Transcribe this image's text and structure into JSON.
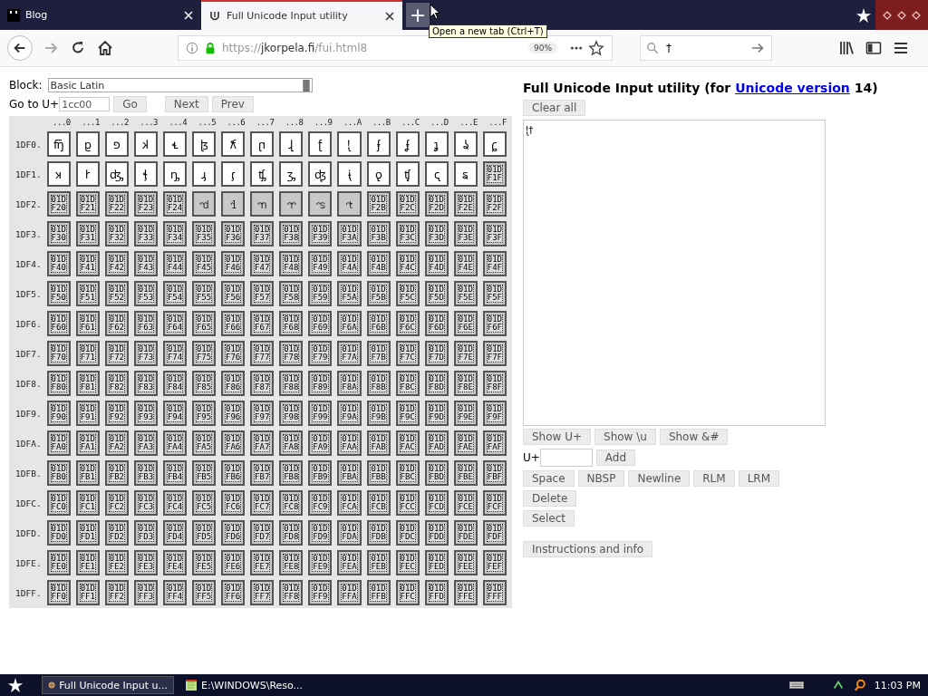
{
  "browser": {
    "tabs": [
      {
        "title": "Blog",
        "selected": false
      },
      {
        "title": "Full Unicode Input utility",
        "selected": true
      }
    ],
    "new_tab": "+",
    "tooltip": "Open a new tab (Ctrl+T)",
    "forward_disabled": true,
    "url": {
      "scheme": "https://",
      "host": "jkorpela.fi",
      "path": "/fui.html8"
    },
    "zoom": "90%",
    "search_value": "†"
  },
  "page": {
    "block_label": "Block:",
    "block_value": "Basic Latin",
    "goto_label": "Go to U+",
    "goto_value": "1cc00",
    "nav_buttons": [
      "Go",
      "Next",
      "Prev"
    ],
    "grid": {
      "columns": [
        "...0",
        "...1",
        "...2",
        "...3",
        "...4",
        "...5",
        "...6",
        "...7",
        "...8",
        "...9",
        "...A",
        "...B",
        "...C",
        "...D",
        "...E",
        "...F"
      ],
      "rows": [
        {
          "label": "1DF0.",
          "cells": [
            {
              "kind": "glyph",
              "char": "𝼀",
              "assigned": true
            },
            {
              "kind": "glyph",
              "char": "𝼁",
              "assigned": true
            },
            {
              "kind": "glyph",
              "char": "𝼂",
              "assigned": true
            },
            {
              "kind": "glyph",
              "char": "𝼃",
              "assigned": true
            },
            {
              "kind": "glyph",
              "char": "𝼄",
              "assigned": true
            },
            {
              "kind": "glyph",
              "char": "𝼅",
              "assigned": true
            },
            {
              "kind": "glyph",
              "char": "𝼆",
              "assigned": true
            },
            {
              "kind": "glyph",
              "char": "𝼇",
              "assigned": true
            },
            {
              "kind": "glyph",
              "char": "𝼈",
              "assigned": true
            },
            {
              "kind": "glyph",
              "char": "𝼉",
              "assigned": true
            },
            {
              "kind": "glyph",
              "char": "𝼊",
              "assigned": true
            },
            {
              "kind": "glyph",
              "char": "𝼋",
              "assigned": true
            },
            {
              "kind": "glyph",
              "char": "𝼌",
              "assigned": true
            },
            {
              "kind": "glyph",
              "char": "𝼍",
              "assigned": true
            },
            {
              "kind": "glyph",
              "char": "𝼎",
              "assigned": true
            },
            {
              "kind": "glyph",
              "char": "𝼏",
              "assigned": true
            }
          ]
        },
        {
          "label": "1DF1.",
          "cells": [
            {
              "kind": "glyph",
              "char": "𝼐",
              "assigned": true
            },
            {
              "kind": "glyph",
              "char": "𝼑",
              "assigned": true
            },
            {
              "kind": "glyph",
              "char": "𝼒",
              "assigned": true
            },
            {
              "kind": "glyph",
              "char": "𝼓",
              "assigned": true
            },
            {
              "kind": "glyph",
              "char": "𝼔",
              "assigned": true
            },
            {
              "kind": "glyph",
              "char": "𝼕",
              "assigned": true
            },
            {
              "kind": "glyph",
              "char": "𝼖",
              "assigned": true
            },
            {
              "kind": "glyph",
              "char": "𝼗",
              "assigned": true
            },
            {
              "kind": "glyph",
              "char": "𝼘",
              "assigned": true
            },
            {
              "kind": "glyph",
              "char": "𝼙",
              "assigned": true
            },
            {
              "kind": "glyph",
              "char": "𝼚",
              "assigned": true
            },
            {
              "kind": "glyph",
              "char": "𝼛",
              "assigned": true
            },
            {
              "kind": "glyph",
              "char": "𝼜",
              "assigned": true
            },
            {
              "kind": "glyph",
              "char": "𝼝",
              "assigned": true
            },
            {
              "kind": "glyph",
              "char": "𝼞",
              "assigned": true
            },
            {
              "kind": "hex",
              "code": "01DF1F",
              "assigned": false
            }
          ]
        },
        {
          "label": "1DF2.",
          "cells": [
            {
              "kind": "hex",
              "code": "01DF20",
              "assigned": false
            },
            {
              "kind": "hex",
              "code": "01DF21",
              "assigned": false
            },
            {
              "kind": "hex",
              "code": "01DF22",
              "assigned": false
            },
            {
              "kind": "hex",
              "code": "01DF23",
              "assigned": false
            },
            {
              "kind": "hex",
              "code": "01DF24",
              "assigned": false
            },
            {
              "kind": "glyph",
              "char": "𝼥",
              "assigned": false
            },
            {
              "kind": "glyph",
              "char": "𝼦",
              "assigned": false
            },
            {
              "kind": "glyph",
              "char": "𝼧",
              "assigned": false
            },
            {
              "kind": "glyph",
              "char": "𝼨",
              "assigned": false
            },
            {
              "kind": "glyph",
              "char": "𝼩",
              "assigned": false
            },
            {
              "kind": "glyph",
              "char": "𝼪",
              "assigned": false
            },
            {
              "kind": "hex",
              "code": "01DF2B",
              "assigned": false
            },
            {
              "kind": "hex",
              "code": "01DF2C",
              "assigned": false
            },
            {
              "kind": "hex",
              "code": "01DF2D",
              "assigned": false
            },
            {
              "kind": "hex",
              "code": "01DF2E",
              "assigned": false
            },
            {
              "kind": "hex",
              "code": "01DF2F",
              "assigned": false
            }
          ]
        },
        {
          "label": "1DF3.",
          "cells": [
            {
              "kind": "hex",
              "code": "01DF30",
              "assigned": false
            },
            {
              "kind": "hex",
              "code": "01DF31",
              "assigned": false
            },
            {
              "kind": "hex",
              "code": "01DF32",
              "assigned": false
            },
            {
              "kind": "hex",
              "code": "01DF33",
              "assigned": false
            },
            {
              "kind": "hex",
              "code": "01DF34",
              "assigned": false
            },
            {
              "kind": "hex",
              "code": "01DF35",
              "assigned": false
            },
            {
              "kind": "hex",
              "code": "01DF36",
              "assigned": false
            },
            {
              "kind": "hex",
              "code": "01DF37",
              "assigned": false
            },
            {
              "kind": "hex",
              "code": "01DF38",
              "assigned": false
            },
            {
              "kind": "hex",
              "code": "01DF39",
              "assigned": false
            },
            {
              "kind": "hex",
              "code": "01DF3A",
              "assigned": false
            },
            {
              "kind": "hex",
              "code": "01DF3B",
              "assigned": false
            },
            {
              "kind": "hex",
              "code": "01DF3C",
              "assigned": false
            },
            {
              "kind": "hex",
              "code": "01DF3D",
              "assigned": false
            },
            {
              "kind": "hex",
              "code": "01DF3E",
              "assigned": false
            },
            {
              "kind": "hex",
              "code": "01DF3F",
              "assigned": false
            }
          ]
        },
        {
          "label": "1DF4.",
          "cells": [
            {
              "kind": "hex",
              "code": "01DF40",
              "assigned": false
            },
            {
              "kind": "hex",
              "code": "01DF41",
              "assigned": false
            },
            {
              "kind": "hex",
              "code": "01DF42",
              "assigned": false
            },
            {
              "kind": "hex",
              "code": "01DF43",
              "assigned": false
            },
            {
              "kind": "hex",
              "code": "01DF44",
              "assigned": false
            },
            {
              "kind": "hex",
              "code": "01DF45",
              "assigned": false
            },
            {
              "kind": "hex",
              "code": "01DF46",
              "assigned": false
            },
            {
              "kind": "hex",
              "code": "01DF47",
              "assigned": false
            },
            {
              "kind": "hex",
              "code": "01DF48",
              "assigned": false
            },
            {
              "kind": "hex",
              "code": "01DF49",
              "assigned": false
            },
            {
              "kind": "hex",
              "code": "01DF4A",
              "assigned": false
            },
            {
              "kind": "hex",
              "code": "01DF4B",
              "assigned": false
            },
            {
              "kind": "hex",
              "code": "01DF4C",
              "assigned": false
            },
            {
              "kind": "hex",
              "code": "01DF4D",
              "assigned": false
            },
            {
              "kind": "hex",
              "code": "01DF4E",
              "assigned": false
            },
            {
              "kind": "hex",
              "code": "01DF4F",
              "assigned": false
            }
          ]
        },
        {
          "label": "1DF5.",
          "cells": [
            {
              "kind": "hex",
              "code": "01DF50",
              "assigned": false
            },
            {
              "kind": "hex",
              "code": "01DF51",
              "assigned": false
            },
            {
              "kind": "hex",
              "code": "01DF52",
              "assigned": false
            },
            {
              "kind": "hex",
              "code": "01DF53",
              "assigned": false
            },
            {
              "kind": "hex",
              "code": "01DF54",
              "assigned": false
            },
            {
              "kind": "hex",
              "code": "01DF55",
              "assigned": false
            },
            {
              "kind": "hex",
              "code": "01DF56",
              "assigned": false
            },
            {
              "kind": "hex",
              "code": "01DF57",
              "assigned": false
            },
            {
              "kind": "hex",
              "code": "01DF58",
              "assigned": false
            },
            {
              "kind": "hex",
              "code": "01DF59",
              "assigned": false
            },
            {
              "kind": "hex",
              "code": "01DF5A",
              "assigned": false
            },
            {
              "kind": "hex",
              "code": "01DF5B",
              "assigned": false
            },
            {
              "kind": "hex",
              "code": "01DF5C",
              "assigned": false
            },
            {
              "kind": "hex",
              "code": "01DF5D",
              "assigned": false
            },
            {
              "kind": "hex",
              "code": "01DF5E",
              "assigned": false
            },
            {
              "kind": "hex",
              "code": "01DF5F",
              "assigned": false
            }
          ]
        },
        {
          "label": "1DF6.",
          "cells": [
            {
              "kind": "hex",
              "code": "01DF60",
              "assigned": false
            },
            {
              "kind": "hex",
              "code": "01DF61",
              "assigned": false
            },
            {
              "kind": "hex",
              "code": "01DF62",
              "assigned": false
            },
            {
              "kind": "hex",
              "code": "01DF63",
              "assigned": false
            },
            {
              "kind": "hex",
              "code": "01DF64",
              "assigned": false
            },
            {
              "kind": "hex",
              "code": "01DF65",
              "assigned": false
            },
            {
              "kind": "hex",
              "code": "01DF66",
              "assigned": false
            },
            {
              "kind": "hex",
              "code": "01DF67",
              "assigned": false
            },
            {
              "kind": "hex",
              "code": "01DF68",
              "assigned": false
            },
            {
              "kind": "hex",
              "code": "01DF69",
              "assigned": false
            },
            {
              "kind": "hex",
              "code": "01DF6A",
              "assigned": false
            },
            {
              "kind": "hex",
              "code": "01DF6B",
              "assigned": false
            },
            {
              "kind": "hex",
              "code": "01DF6C",
              "assigned": false
            },
            {
              "kind": "hex",
              "code": "01DF6D",
              "assigned": false
            },
            {
              "kind": "hex",
              "code": "01DF6E",
              "assigned": false
            },
            {
              "kind": "hex",
              "code": "01DF6F",
              "assigned": false
            }
          ]
        },
        {
          "label": "1DF7.",
          "cells": [
            {
              "kind": "hex",
              "code": "01DF70",
              "assigned": false
            },
            {
              "kind": "hex",
              "code": "01DF71",
              "assigned": false
            },
            {
              "kind": "hex",
              "code": "01DF72",
              "assigned": false
            },
            {
              "kind": "hex",
              "code": "01DF73",
              "assigned": false
            },
            {
              "kind": "hex",
              "code": "01DF74",
              "assigned": false
            },
            {
              "kind": "hex",
              "code": "01DF75",
              "assigned": false
            },
            {
              "kind": "hex",
              "code": "01DF76",
              "assigned": false
            },
            {
              "kind": "hex",
              "code": "01DF77",
              "assigned": false
            },
            {
              "kind": "hex",
              "code": "01DF78",
              "assigned": false
            },
            {
              "kind": "hex",
              "code": "01DF79",
              "assigned": false
            },
            {
              "kind": "hex",
              "code": "01DF7A",
              "assigned": false
            },
            {
              "kind": "hex",
              "code": "01DF7B",
              "assigned": false
            },
            {
              "kind": "hex",
              "code": "01DF7C",
              "assigned": false
            },
            {
              "kind": "hex",
              "code": "01DF7D",
              "assigned": false
            },
            {
              "kind": "hex",
              "code": "01DF7E",
              "assigned": false
            },
            {
              "kind": "hex",
              "code": "01DF7F",
              "assigned": false
            }
          ]
        },
        {
          "label": "1DF8.",
          "cells": [
            {
              "kind": "hex",
              "code": "01DF80",
              "assigned": false
            },
            {
              "kind": "hex",
              "code": "01DF81",
              "assigned": false
            },
            {
              "kind": "hex",
              "code": "01DF82",
              "assigned": false
            },
            {
              "kind": "hex",
              "code": "01DF83",
              "assigned": false
            },
            {
              "kind": "hex",
              "code": "01DF84",
              "assigned": false
            },
            {
              "kind": "hex",
              "code": "01DF85",
              "assigned": false
            },
            {
              "kind": "hex",
              "code": "01DF86",
              "assigned": false
            },
            {
              "kind": "hex",
              "code": "01DF87",
              "assigned": false
            },
            {
              "kind": "hex",
              "code": "01DF88",
              "assigned": false
            },
            {
              "kind": "hex",
              "code": "01DF89",
              "assigned": false
            },
            {
              "kind": "hex",
              "code": "01DF8A",
              "assigned": false
            },
            {
              "kind": "hex",
              "code": "01DF8B",
              "assigned": false
            },
            {
              "kind": "hex",
              "code": "01DF8C",
              "assigned": false
            },
            {
              "kind": "hex",
              "code": "01DF8D",
              "assigned": false
            },
            {
              "kind": "hex",
              "code": "01DF8E",
              "assigned": false
            },
            {
              "kind": "hex",
              "code": "01DF8F",
              "assigned": false
            }
          ]
        },
        {
          "label": "1DF9.",
          "cells": [
            {
              "kind": "hex",
              "code": "01DF90",
              "assigned": false
            },
            {
              "kind": "hex",
              "code": "01DF91",
              "assigned": false
            },
            {
              "kind": "hex",
              "code": "01DF92",
              "assigned": false
            },
            {
              "kind": "hex",
              "code": "01DF93",
              "assigned": false
            },
            {
              "kind": "hex",
              "code": "01DF94",
              "assigned": false
            },
            {
              "kind": "hex",
              "code": "01DF95",
              "assigned": false
            },
            {
              "kind": "hex",
              "code": "01DF96",
              "assigned": false
            },
            {
              "kind": "hex",
              "code": "01DF97",
              "assigned": false
            },
            {
              "kind": "hex",
              "code": "01DF98",
              "assigned": false
            },
            {
              "kind": "hex",
              "code": "01DF99",
              "assigned": false
            },
            {
              "kind": "hex",
              "code": "01DF9A",
              "assigned": false
            },
            {
              "kind": "hex",
              "code": "01DF9B",
              "assigned": false
            },
            {
              "kind": "hex",
              "code": "01DF9C",
              "assigned": false
            },
            {
              "kind": "hex",
              "code": "01DF9D",
              "assigned": false
            },
            {
              "kind": "hex",
              "code": "01DF9E",
              "assigned": false
            },
            {
              "kind": "hex",
              "code": "01DF9F",
              "assigned": false
            }
          ]
        },
        {
          "label": "1DFA.",
          "cells": [
            {
              "kind": "hex",
              "code": "01DFA0",
              "assigned": false
            },
            {
              "kind": "hex",
              "code": "01DFA1",
              "assigned": false
            },
            {
              "kind": "hex",
              "code": "01DFA2",
              "assigned": false
            },
            {
              "kind": "hex",
              "code": "01DFA3",
              "assigned": false
            },
            {
              "kind": "hex",
              "code": "01DFA4",
              "assigned": false
            },
            {
              "kind": "hex",
              "code": "01DFA5",
              "assigned": false
            },
            {
              "kind": "hex",
              "code": "01DFA6",
              "assigned": false
            },
            {
              "kind": "hex",
              "code": "01DFA7",
              "assigned": false
            },
            {
              "kind": "hex",
              "code": "01DFA8",
              "assigned": false
            },
            {
              "kind": "hex",
              "code": "01DFA9",
              "assigned": false
            },
            {
              "kind": "hex",
              "code": "01DFAA",
              "assigned": false
            },
            {
              "kind": "hex",
              "code": "01DFAB",
              "assigned": false
            },
            {
              "kind": "hex",
              "code": "01DFAC",
              "assigned": false
            },
            {
              "kind": "hex",
              "code": "01DFAD",
              "assigned": false
            },
            {
              "kind": "hex",
              "code": "01DFAE",
              "assigned": false
            },
            {
              "kind": "hex",
              "code": "01DFAF",
              "assigned": false
            }
          ]
        },
        {
          "label": "1DFB.",
          "cells": [
            {
              "kind": "hex",
              "code": "01DFB0",
              "assigned": false
            },
            {
              "kind": "hex",
              "code": "01DFB1",
              "assigned": false
            },
            {
              "kind": "hex",
              "code": "01DFB2",
              "assigned": false
            },
            {
              "kind": "hex",
              "code": "01DFB3",
              "assigned": false
            },
            {
              "kind": "hex",
              "code": "01DFB4",
              "assigned": false
            },
            {
              "kind": "hex",
              "code": "01DFB5",
              "assigned": false
            },
            {
              "kind": "hex",
              "code": "01DFB6",
              "assigned": false
            },
            {
              "kind": "hex",
              "code": "01DFB7",
              "assigned": false
            },
            {
              "kind": "hex",
              "code": "01DFB8",
              "assigned": false
            },
            {
              "kind": "hex",
              "code": "01DFB9",
              "assigned": false
            },
            {
              "kind": "hex",
              "code": "01DFBA",
              "assigned": false
            },
            {
              "kind": "hex",
              "code": "01DFBB",
              "assigned": false
            },
            {
              "kind": "hex",
              "code": "01DFBC",
              "assigned": false
            },
            {
              "kind": "hex",
              "code": "01DFBD",
              "assigned": false
            },
            {
              "kind": "hex",
              "code": "01DFBE",
              "assigned": false
            },
            {
              "kind": "hex",
              "code": "01DFBF",
              "assigned": false
            }
          ]
        },
        {
          "label": "1DFC.",
          "cells": [
            {
              "kind": "hex",
              "code": "01DFC0",
              "assigned": false
            },
            {
              "kind": "hex",
              "code": "01DFC1",
              "assigned": false
            },
            {
              "kind": "hex",
              "code": "01DFC2",
              "assigned": false
            },
            {
              "kind": "hex",
              "code": "01DFC3",
              "assigned": false
            },
            {
              "kind": "hex",
              "code": "01DFC4",
              "assigned": false
            },
            {
              "kind": "hex",
              "code": "01DFC5",
              "assigned": false
            },
            {
              "kind": "hex",
              "code": "01DFC6",
              "assigned": false
            },
            {
              "kind": "hex",
              "code": "01DFC7",
              "assigned": false
            },
            {
              "kind": "hex",
              "code": "01DFC8",
              "assigned": false
            },
            {
              "kind": "hex",
              "code": "01DFC9",
              "assigned": false
            },
            {
              "kind": "hex",
              "code": "01DFCA",
              "assigned": false
            },
            {
              "kind": "hex",
              "code": "01DFCB",
              "assigned": false
            },
            {
              "kind": "hex",
              "code": "01DFCC",
              "assigned": false
            },
            {
              "kind": "hex",
              "code": "01DFCD",
              "assigned": false
            },
            {
              "kind": "hex",
              "code": "01DFCE",
              "assigned": false
            },
            {
              "kind": "hex",
              "code": "01DFCF",
              "assigned": false
            }
          ]
        },
        {
          "label": "1DFD.",
          "cells": [
            {
              "kind": "hex",
              "code": "01DFD0",
              "assigned": false
            },
            {
              "kind": "hex",
              "code": "01DFD1",
              "assigned": false
            },
            {
              "kind": "hex",
              "code": "01DFD2",
              "assigned": false
            },
            {
              "kind": "hex",
              "code": "01DFD3",
              "assigned": false
            },
            {
              "kind": "hex",
              "code": "01DFD4",
              "assigned": false
            },
            {
              "kind": "hex",
              "code": "01DFD5",
              "assigned": false
            },
            {
              "kind": "hex",
              "code": "01DFD6",
              "assigned": false
            },
            {
              "kind": "hex",
              "code": "01DFD7",
              "assigned": false
            },
            {
              "kind": "hex",
              "code": "01DFD8",
              "assigned": false
            },
            {
              "kind": "hex",
              "code": "01DFD9",
              "assigned": false
            },
            {
              "kind": "hex",
              "code": "01DFDA",
              "assigned": false
            },
            {
              "kind": "hex",
              "code": "01DFDB",
              "assigned": false
            },
            {
              "kind": "hex",
              "code": "01DFDC",
              "assigned": false
            },
            {
              "kind": "hex",
              "code": "01DFDD",
              "assigned": false
            },
            {
              "kind": "hex",
              "code": "01DFDE",
              "assigned": false
            },
            {
              "kind": "hex",
              "code": "01DFDF",
              "assigned": false
            }
          ]
        },
        {
          "label": "1DFE.",
          "cells": [
            {
              "kind": "hex",
              "code": "01DFE0",
              "assigned": false
            },
            {
              "kind": "hex",
              "code": "01DFE1",
              "assigned": false
            },
            {
              "kind": "hex",
              "code": "01DFE2",
              "assigned": false
            },
            {
              "kind": "hex",
              "code": "01DFE3",
              "assigned": false
            },
            {
              "kind": "hex",
              "code": "01DFE4",
              "assigned": false
            },
            {
              "kind": "hex",
              "code": "01DFE5",
              "assigned": false
            },
            {
              "kind": "hex",
              "code": "01DFE6",
              "assigned": false
            },
            {
              "kind": "hex",
              "code": "01DFE7",
              "assigned": false
            },
            {
              "kind": "hex",
              "code": "01DFE8",
              "assigned": false
            },
            {
              "kind": "hex",
              "code": "01DFE9",
              "assigned": false
            },
            {
              "kind": "hex",
              "code": "01DFEA",
              "assigned": false
            },
            {
              "kind": "hex",
              "code": "01DFEB",
              "assigned": false
            },
            {
              "kind": "hex",
              "code": "01DFEC",
              "assigned": false
            },
            {
              "kind": "hex",
              "code": "01DFED",
              "assigned": false
            },
            {
              "kind": "hex",
              "code": "01DFEE",
              "assigned": false
            },
            {
              "kind": "hex",
              "code": "01DFEF",
              "assigned": false
            }
          ]
        },
        {
          "label": "1DFF.",
          "cells": [
            {
              "kind": "hex",
              "code": "01DFF0",
              "assigned": false
            },
            {
              "kind": "hex",
              "code": "01DFF1",
              "assigned": false
            },
            {
              "kind": "hex",
              "code": "01DFF2",
              "assigned": false
            },
            {
              "kind": "hex",
              "code": "01DFF3",
              "assigned": false
            },
            {
              "kind": "hex",
              "code": "01DFF4",
              "assigned": false
            },
            {
              "kind": "hex",
              "code": "01DFF5",
              "assigned": false
            },
            {
              "kind": "hex",
              "code": "01DFF6",
              "assigned": false
            },
            {
              "kind": "hex",
              "code": "01DFF7",
              "assigned": false
            },
            {
              "kind": "hex",
              "code": "01DFF8",
              "assigned": false
            },
            {
              "kind": "hex",
              "code": "01DFF9",
              "assigned": false
            },
            {
              "kind": "hex",
              "code": "01DFFA",
              "assigned": false
            },
            {
              "kind": "hex",
              "code": "01DFFB",
              "assigned": false
            },
            {
              "kind": "hex",
              "code": "01DFFC",
              "assigned": false
            },
            {
              "kind": "hex",
              "code": "01DFFD",
              "assigned": false
            },
            {
              "kind": "hex",
              "code": "01DFFE",
              "assigned": false
            },
            {
              "kind": "hex",
              "code": "01DFFF",
              "assigned": false
            }
          ]
        }
      ]
    },
    "heading": {
      "before": "Full Unicode Input utility (for ",
      "link": "Unicode version",
      "after": " 14)"
    },
    "clear_button": "Clear all",
    "text_value": "𝼊†",
    "show_buttons": [
      "Show U+",
      "Show \\u",
      "Show &#"
    ],
    "add_label": "U+",
    "add_button": "Add",
    "char_buttons": [
      "Space",
      "NBSP",
      "Newline",
      "RLM",
      "LRM"
    ],
    "delete_button": "Delete",
    "select_button": "Select",
    "info_button": "Instructions and info"
  },
  "taskbar": {
    "tasks": [
      {
        "title": "Full Unicode Input u...",
        "selected": true
      },
      {
        "title": "E:\\WINDOWS\\Reso...",
        "selected": false
      }
    ],
    "clock": "11:03 PM"
  }
}
